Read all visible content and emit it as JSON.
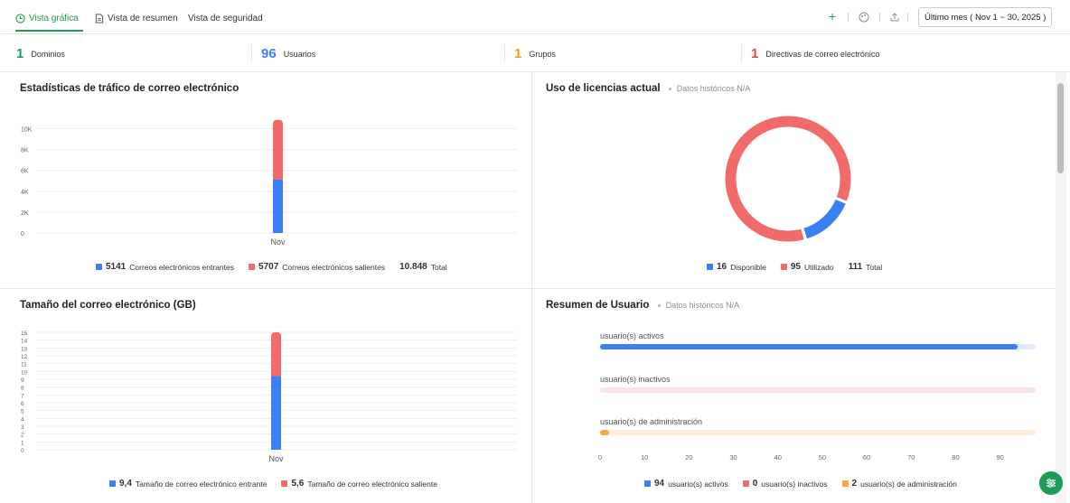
{
  "tabs": [
    {
      "label": "Vista gráfica",
      "icon": "clock-chart-icon",
      "active": true
    },
    {
      "label": "Vista de resumen",
      "icon": "document-icon",
      "active": false
    },
    {
      "label": "Vista de seguridad",
      "icon": "",
      "active": false
    }
  ],
  "toolbar": {
    "range_label": "Último mes ( Nov 1 ~ 30, 2025 )",
    "add_icon": "plus-icon",
    "palette_icon": "palette-icon",
    "export_icon": "export-icon"
  },
  "stats": [
    {
      "value": "1",
      "label": "Dominios",
      "color": "#1e9b57"
    },
    {
      "value": "96",
      "label": "Usuarios",
      "color": "#3b82f6"
    },
    {
      "value": "1",
      "label": "Grupos",
      "color": "#f59e0b"
    },
    {
      "value": "1",
      "label": "Directivas de correo electrónico",
      "color": "#ef4444"
    }
  ],
  "traffic": {
    "title": "Estadísticas de tráfico de correo electrónico",
    "legend": [
      {
        "value": "5141",
        "label": "Correos electrónicos entrantes",
        "color": "#3b7ff5"
      },
      {
        "value": "5707",
        "label": "Correos electrónicos salientes",
        "color": "#f26b6b"
      }
    ],
    "total_value": "10.848",
    "total_label": "Total"
  },
  "license": {
    "title": "Uso de licencias actual",
    "subtitle": "Datos históricos N/A",
    "legend": [
      {
        "value": "16",
        "label": "Disponible",
        "color": "#3b7ff5"
      },
      {
        "value": "95",
        "label": "Utilizado",
        "color": "#f26b6b"
      }
    ],
    "total_value": "111",
    "total_label": "Total"
  },
  "size": {
    "title": "Tamaño del correo electrónico (GB)",
    "legend": [
      {
        "value": "9,4",
        "label": "Tamaño de correo electrónico entrante",
        "color": "#3b7ff5"
      },
      {
        "value": "5,6",
        "label": "Tamaño de correo electrónico saliente",
        "color": "#f26b6b"
      }
    ]
  },
  "users": {
    "title": "Resumen de Usuario",
    "subtitle": "Datos históricos N/A",
    "legend": [
      {
        "value": "94",
        "label": "usuario(s) activos",
        "color": "#3b7ff5"
      },
      {
        "value": "0",
        "label": "usuario(s) inactivos",
        "color": "#f26b6b"
      },
      {
        "value": "2",
        "label": "usuario(s) de administración",
        "color": "#f5a742"
      }
    ]
  },
  "chart_data": [
    {
      "type": "bar",
      "title": "Estadísticas de tráfico de correo electrónico",
      "stacked": true,
      "categories": [
        "Nov"
      ],
      "yticks": [
        "0",
        "2K",
        "4K",
        "6K",
        "8K",
        "10K"
      ],
      "ylim": [
        0,
        11000
      ],
      "grid": true,
      "series": [
        {
          "name": "Correos electrónicos entrantes",
          "values": [
            5141
          ],
          "color": "#3b7ff5"
        },
        {
          "name": "Correos electrónicos salientes",
          "values": [
            5707
          ],
          "color": "#f26b6b"
        }
      ]
    },
    {
      "type": "pie",
      "title": "Uso de licencias actual",
      "donut": true,
      "categories": [
        "Disponible",
        "Utilizado"
      ],
      "values": [
        16,
        95
      ],
      "colors": [
        "#3b7ff5",
        "#f26b6b"
      ]
    },
    {
      "type": "bar",
      "title": "Tamaño del correo electrónico (GB)",
      "stacked": true,
      "categories": [
        "Nov"
      ],
      "yticks": [
        "0",
        "1",
        "2",
        "3",
        "4",
        "5",
        "6",
        "7",
        "8",
        "9",
        "10",
        "11",
        "12",
        "13",
        "14",
        "15"
      ],
      "ylim": [
        0,
        15
      ],
      "grid": true,
      "series": [
        {
          "name": "Tamaño de correo electrónico entrante",
          "values": [
            9.4
          ],
          "color": "#3b7ff5"
        },
        {
          "name": "Tamaño de correo electrónico saliente",
          "values": [
            5.6
          ],
          "color": "#f26b6b"
        }
      ]
    },
    {
      "type": "bar",
      "title": "Resumen de Usuario",
      "horizontal": true,
      "categories": [
        "usuario(s) activos",
        "usuario(s) inactivos",
        "usuario(s) de administración"
      ],
      "values": [
        94,
        0,
        2
      ],
      "xlim": [
        0,
        98
      ],
      "xticks": [
        "0",
        "10",
        "20",
        "30",
        "40",
        "50",
        "60",
        "70",
        "80",
        "90"
      ],
      "colors": [
        "#3b7ff5",
        "#f26b6b",
        "#f5a742"
      ],
      "track_colors": [
        "#dde9fd",
        "#fde4e4",
        "#fdecdc"
      ]
    }
  ]
}
